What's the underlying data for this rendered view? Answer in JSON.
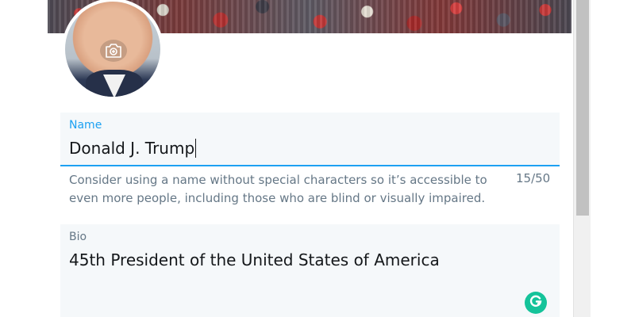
{
  "header": {
    "banner": "crowd-photo"
  },
  "avatar": {
    "camera_icon": "camera-plus-icon"
  },
  "name_field": {
    "label": "Name",
    "value": "Donald J. Trump",
    "helper": "Consider using a name without special characters so it’s accessible to even more people, including those who are blind or visually impaired.",
    "counter": "15/50",
    "accent_color": "#1da1f2"
  },
  "bio_field": {
    "label": "Bio",
    "value": "45th President of the United States of America"
  },
  "grammarly": {
    "icon": "grammarly-icon",
    "color": "#15c39a"
  }
}
